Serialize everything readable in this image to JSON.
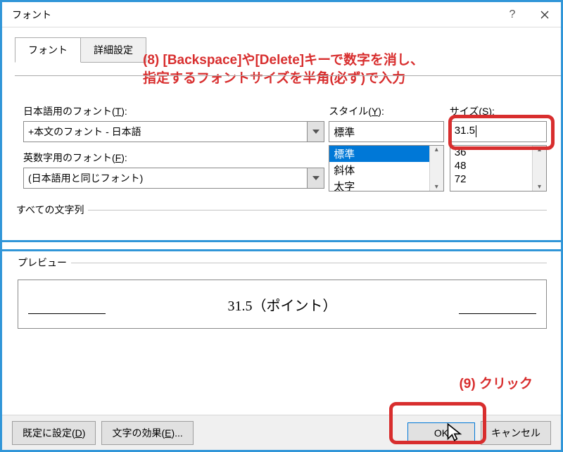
{
  "title": "フォント",
  "tabs": {
    "font": "フォント",
    "advanced": "詳細設定"
  },
  "annotations": {
    "step8a": "(8) [Backspace]や[Delete]キーで数字を消し、",
    "step8b": "指定するフォントサイズを半角(必ず)で入力",
    "step9": "(9) クリック"
  },
  "labels": {
    "jfont": "日本語用のフォント(",
    "jfont_key": "T",
    "jfont_end": "):",
    "efont": "英数字用のフォント(",
    "efont_key": "F",
    "efont_end": "):",
    "style": "スタイル(",
    "style_key": "Y",
    "style_end": "):",
    "size": "サイズ(",
    "size_key": "S",
    "size_end": "):",
    "allchars": "すべての文字列",
    "preview": "プレビュー"
  },
  "values": {
    "jfont": "+本文のフォント - 日本語",
    "efont": "(日本語用と同じフォント)",
    "style": "標準",
    "size": "31.5"
  },
  "style_options": [
    "標準",
    "斜体",
    "太字"
  ],
  "size_options": [
    "36",
    "48",
    "72"
  ],
  "preview_text": "31.5（ポイント）",
  "buttons": {
    "setdefault": "既定に設定(",
    "setdefault_key": "D",
    "setdefault_end": ")",
    "texteffects": "文字の効果(",
    "texteffects_key": "E",
    "texteffects_end": ")...",
    "ok": "OK",
    "cancel": "キャンセル"
  }
}
